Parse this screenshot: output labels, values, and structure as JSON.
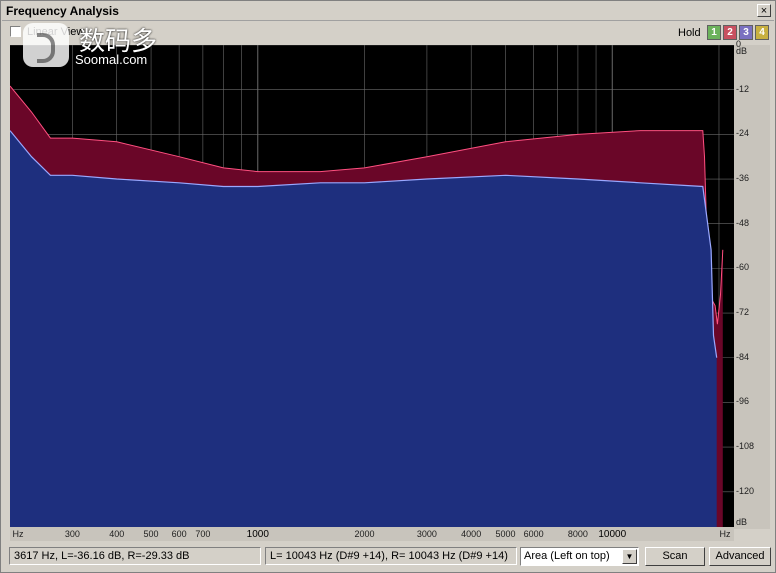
{
  "window": {
    "title": "Frequency Analysis",
    "close_glyph": "×"
  },
  "toolbar": {
    "linear_view_label": "Linear View",
    "hold_label": "Hold",
    "hold_buttons": [
      {
        "label": "1",
        "color": "#6cb25c"
      },
      {
        "label": "2",
        "color": "#c85060"
      },
      {
        "label": "3",
        "color": "#7a70c0"
      },
      {
        "label": "4",
        "color": "#c8b040"
      }
    ]
  },
  "watermark": {
    "logo_icon": "soomal-logo-icon",
    "chinese": "数码多",
    "english": "Soomal.com"
  },
  "chart_data": {
    "type": "area",
    "xscale": "log",
    "xlim": [
      200,
      22050
    ],
    "ylim": [
      -130,
      0
    ],
    "y_unit_label": "dB",
    "x_unit_label": "Hz",
    "y_ticks": [
      "dB",
      "0",
      "-12",
      "-24",
      "-36",
      "-48",
      "-60",
      "-72",
      "-84",
      "-96",
      "-108",
      "-120",
      "dB"
    ],
    "x_ticks": [
      {
        "label": "Hz",
        "major": false
      },
      {
        "label": "300",
        "major": false
      },
      {
        "label": "400",
        "major": false
      },
      {
        "label": "500",
        "major": false
      },
      {
        "label": "600",
        "major": false
      },
      {
        "label": "700",
        "major": false
      },
      {
        "label": "1000",
        "major": true
      },
      {
        "label": "2000",
        "major": false
      },
      {
        "label": "3000",
        "major": false
      },
      {
        "label": "4000",
        "major": false
      },
      {
        "label": "5000",
        "major": false
      },
      {
        "label": "6000",
        "major": false
      },
      {
        "label": "8000",
        "major": false
      },
      {
        "label": "10000",
        "major": true
      },
      {
        "label": "Hz",
        "major": false
      }
    ],
    "grid": true,
    "colors": {
      "left": "#1e2f7e",
      "right": "#6a0628",
      "left_line": "#9aa8ff",
      "right_line": "#ff5080",
      "grid": "#6a6a6a"
    },
    "series": [
      {
        "key": "left",
        "x": [
          200,
          230,
          260,
          300,
          400,
          600,
          800,
          1000,
          1500,
          2000,
          3000,
          5000,
          8000,
          12000,
          18000,
          19000,
          19300,
          19700
        ],
        "y": [
          -23,
          -30,
          -35,
          -35,
          -36,
          -37,
          -38,
          -38,
          -37,
          -37,
          -36,
          -35,
          -36,
          -37,
          -38,
          -55,
          -78,
          -84
        ]
      },
      {
        "key": "right",
        "x": [
          200,
          230,
          260,
          300,
          400,
          600,
          800,
          1000,
          1500,
          2000,
          3000,
          5000,
          8000,
          12000,
          18000,
          18200,
          18600,
          19000,
          19500,
          19800,
          20200,
          20500
        ],
        "y": [
          -11,
          -18,
          -25,
          -25,
          -26,
          -30,
          -33,
          -34,
          -34,
          -33,
          -30,
          -26,
          -24,
          -23,
          -23,
          -30,
          -60,
          -68,
          -70,
          -75,
          -67,
          -55
        ]
      }
    ]
  },
  "status": {
    "cursor_readout": "3617 Hz, L=-36.16 dB, R=-29.33 dB",
    "peak_readout": "L=  10043 Hz (D#9 +14), R=  10043 Hz (D#9 +14)",
    "view_mode_selected": "Area (Left on top)",
    "scan_label": "Scan",
    "advanced_label": "Advanced"
  }
}
